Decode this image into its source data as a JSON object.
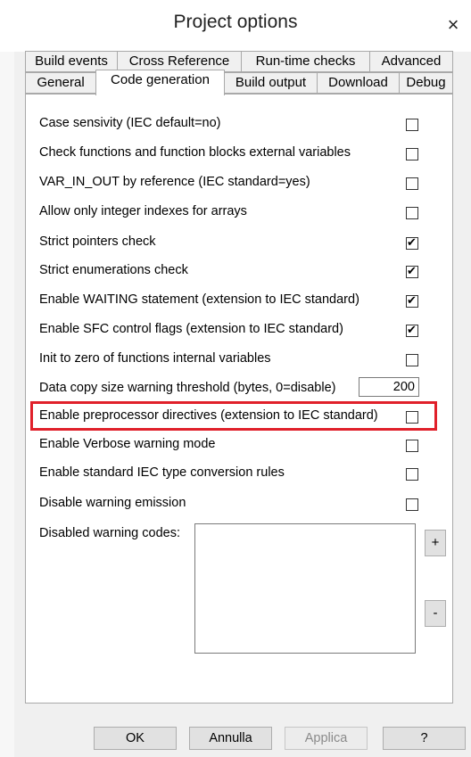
{
  "window": {
    "title": "Project options",
    "close": "×"
  },
  "tabs_row1": [
    "Build events",
    "Cross Reference",
    "Run-time checks",
    "Advanced"
  ],
  "tabs_row2": [
    "General",
    "Code generation",
    "Build output",
    "Download",
    "Debug"
  ],
  "active_tab": "Code generation",
  "options": [
    {
      "label": "Case sensivity (IEC default=no)",
      "checked": false
    },
    {
      "label": "Check functions and function blocks external variables",
      "checked": false
    },
    {
      "label": "VAR_IN_OUT by reference (IEC standard=yes)",
      "checked": false
    },
    {
      "label": "Allow only integer indexes for arrays",
      "checked": false
    },
    {
      "label": "Strict pointers check",
      "checked": true
    },
    {
      "label": "Strict enumerations check",
      "checked": true
    },
    {
      "label": "Enable WAITING statement (extension to IEC standard)",
      "checked": true
    },
    {
      "label": "Enable SFC control flags (extension to IEC standard)",
      "checked": true
    },
    {
      "label": "Init to zero of functions internal variables",
      "checked": false
    }
  ],
  "threshold": {
    "label": "Data copy size warning threshold (bytes, 0=disable)",
    "value": "200"
  },
  "options2": [
    {
      "label": "Enable preprocessor directives (extension to IEC standard)",
      "checked": false
    },
    {
      "label": "Enable Verbose warning mode",
      "checked": false
    },
    {
      "label": "Enable standard IEC type conversion rules",
      "checked": false
    },
    {
      "label": "Disable warning emission",
      "checked": false
    }
  ],
  "disabled_codes": {
    "label": "Disabled warning codes:",
    "add": "+",
    "remove": "-"
  },
  "buttons": {
    "ok": "OK",
    "cancel": "Annulla",
    "apply": "Applica",
    "help": "?"
  },
  "colors": {
    "highlight": "#e0202a"
  }
}
